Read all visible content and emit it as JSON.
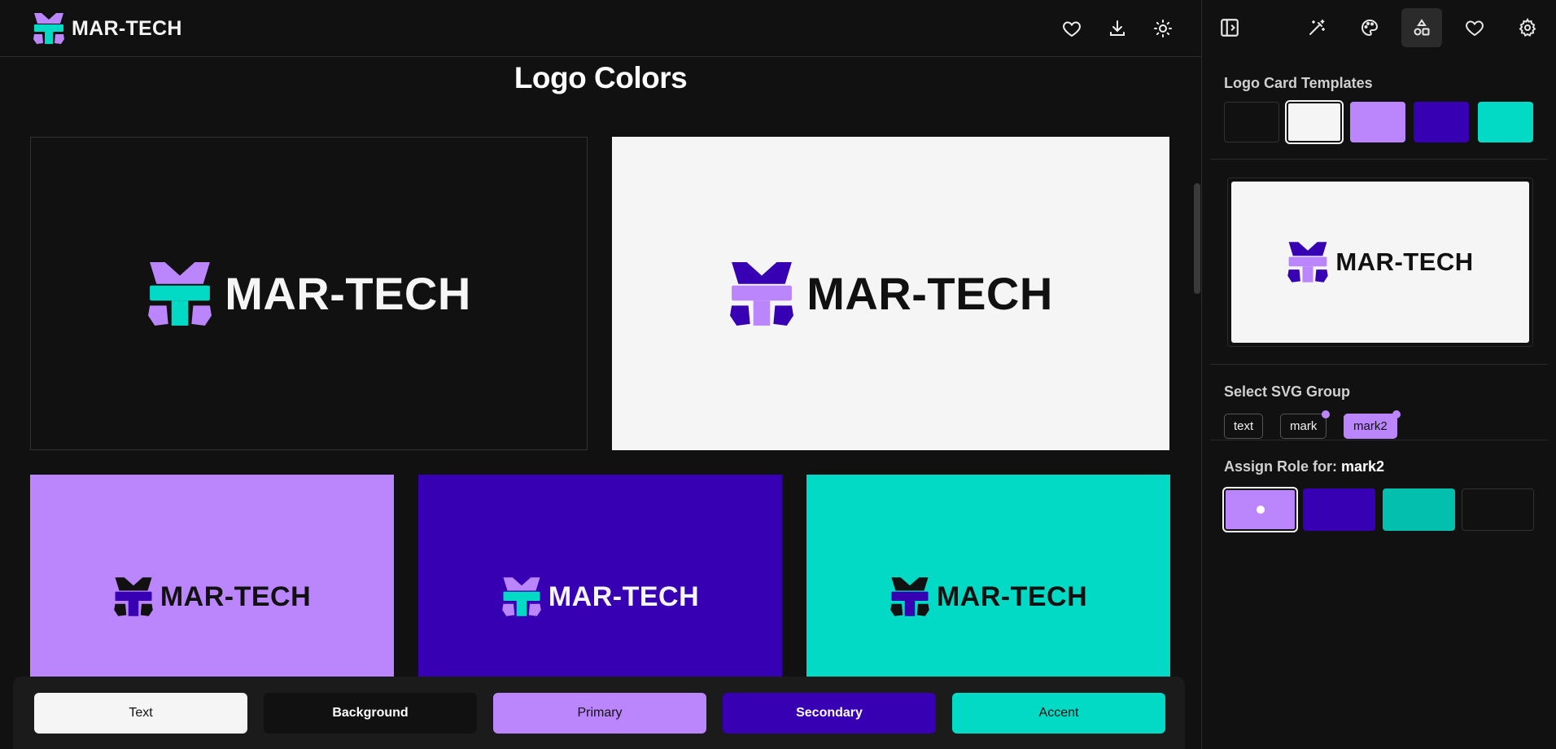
{
  "header": {
    "brand": "MAR-TECH",
    "icons": [
      "heart-icon",
      "download-icon",
      "sun-icon"
    ]
  },
  "main": {
    "title": "Logo Colors",
    "cards": [
      {
        "name": "dark",
        "bg": "#111111",
        "text": "MAR-TECH",
        "text_color": "#f5f5f6",
        "mark_top": "#bb86fc",
        "mark_mid": "#03dac6",
        "mark_bot": "#bb86fc"
      },
      {
        "name": "light",
        "bg": "#f5f5f6",
        "text": "MAR-TECH",
        "text_color": "#111111",
        "mark_top": "#3700b3",
        "mark_mid": "#bb86fc",
        "mark_bot": "#3700b3"
      },
      {
        "name": "purple",
        "bg": "#bb86fc",
        "text": "MAR-TECH",
        "text_color": "#111111",
        "mark_top": "#111111",
        "mark_mid": "#3700b3",
        "mark_bot": "#111111"
      },
      {
        "name": "indigo",
        "bg": "#3700b3",
        "text": "MAR-TECH",
        "text_color": "#f5f5f6",
        "mark_top": "#bb86fc",
        "mark_mid": "#03dac6",
        "mark_bot": "#bb86fc"
      },
      {
        "name": "teal",
        "bg": "#03dac6",
        "text": "MAR-TECH",
        "text_color": "#111111",
        "mark_top": "#111111",
        "mark_mid": "#3700b3",
        "mark_bot": "#111111"
      }
    ]
  },
  "roles": {
    "text": "Text",
    "background": "Background",
    "primary": "Primary",
    "secondary": "Secondary",
    "accent": "Accent"
  },
  "colors": {
    "text": "#f5f5f6",
    "background": "#111111",
    "primary": "#bb86fc",
    "secondary": "#3700b3",
    "accent": "#03dac6"
  },
  "sidebar": {
    "tabs": [
      "panel-toggle-icon",
      "magic-wand-icon",
      "palette-icon",
      "shapes-icon",
      "heart-icon",
      "gear-icon"
    ],
    "active_tab": "shapes-icon",
    "templates_title": "Logo Card Templates",
    "templates": [
      "#111111",
      "#f5f5f6",
      "#bb86fc",
      "#3700b3",
      "#03dac6"
    ],
    "preview_text": "MAR-TECH",
    "svg_group_title": "Select SVG Group",
    "groups": [
      "text",
      "mark",
      "mark2"
    ],
    "selected_group": "mark2",
    "assign_label": "Assign Role for: ",
    "assign_target": "mark2",
    "role_swatches": [
      "#bb86fc",
      "#3700b3",
      "#03bfae",
      "#111111"
    ]
  }
}
